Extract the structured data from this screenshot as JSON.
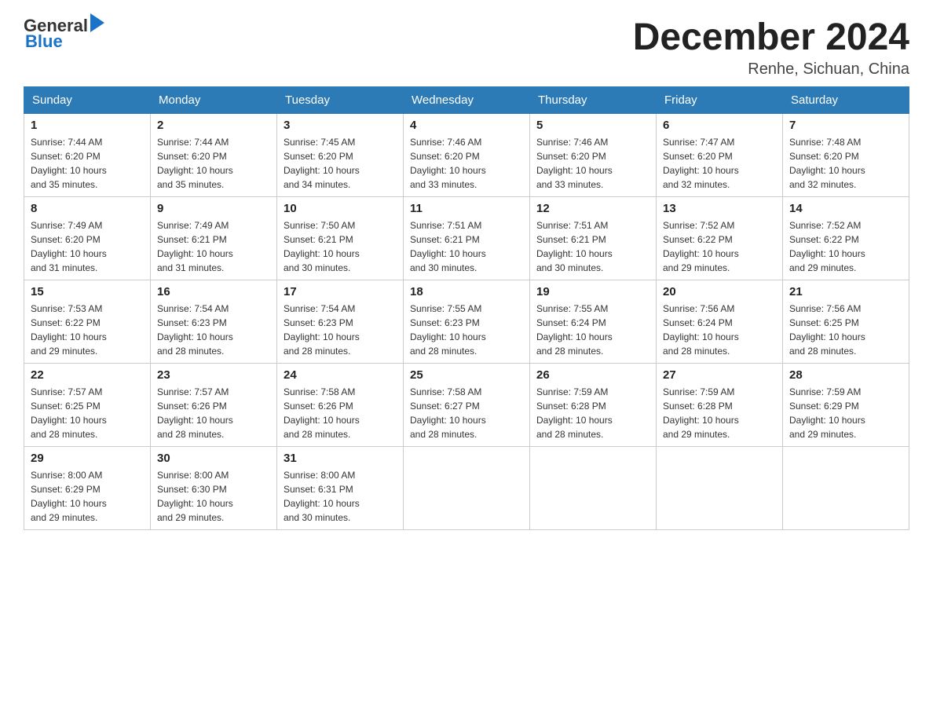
{
  "header": {
    "logo_general": "General",
    "logo_blue": "Blue",
    "title": "December 2024",
    "location": "Renhe, Sichuan, China"
  },
  "calendar": {
    "days_of_week": [
      "Sunday",
      "Monday",
      "Tuesday",
      "Wednesday",
      "Thursday",
      "Friday",
      "Saturday"
    ],
    "weeks": [
      [
        {
          "day": "1",
          "sunrise": "7:44 AM",
          "sunset": "6:20 PM",
          "daylight": "10 hours and 35 minutes."
        },
        {
          "day": "2",
          "sunrise": "7:44 AM",
          "sunset": "6:20 PM",
          "daylight": "10 hours and 35 minutes."
        },
        {
          "day": "3",
          "sunrise": "7:45 AM",
          "sunset": "6:20 PM",
          "daylight": "10 hours and 34 minutes."
        },
        {
          "day": "4",
          "sunrise": "7:46 AM",
          "sunset": "6:20 PM",
          "daylight": "10 hours and 33 minutes."
        },
        {
          "day": "5",
          "sunrise": "7:46 AM",
          "sunset": "6:20 PM",
          "daylight": "10 hours and 33 minutes."
        },
        {
          "day": "6",
          "sunrise": "7:47 AM",
          "sunset": "6:20 PM",
          "daylight": "10 hours and 32 minutes."
        },
        {
          "day": "7",
          "sunrise": "7:48 AM",
          "sunset": "6:20 PM",
          "daylight": "10 hours and 32 minutes."
        }
      ],
      [
        {
          "day": "8",
          "sunrise": "7:49 AM",
          "sunset": "6:20 PM",
          "daylight": "10 hours and 31 minutes."
        },
        {
          "day": "9",
          "sunrise": "7:49 AM",
          "sunset": "6:21 PM",
          "daylight": "10 hours and 31 minutes."
        },
        {
          "day": "10",
          "sunrise": "7:50 AM",
          "sunset": "6:21 PM",
          "daylight": "10 hours and 30 minutes."
        },
        {
          "day": "11",
          "sunrise": "7:51 AM",
          "sunset": "6:21 PM",
          "daylight": "10 hours and 30 minutes."
        },
        {
          "day": "12",
          "sunrise": "7:51 AM",
          "sunset": "6:21 PM",
          "daylight": "10 hours and 30 minutes."
        },
        {
          "day": "13",
          "sunrise": "7:52 AM",
          "sunset": "6:22 PM",
          "daylight": "10 hours and 29 minutes."
        },
        {
          "day": "14",
          "sunrise": "7:52 AM",
          "sunset": "6:22 PM",
          "daylight": "10 hours and 29 minutes."
        }
      ],
      [
        {
          "day": "15",
          "sunrise": "7:53 AM",
          "sunset": "6:22 PM",
          "daylight": "10 hours and 29 minutes."
        },
        {
          "day": "16",
          "sunrise": "7:54 AM",
          "sunset": "6:23 PM",
          "daylight": "10 hours and 28 minutes."
        },
        {
          "day": "17",
          "sunrise": "7:54 AM",
          "sunset": "6:23 PM",
          "daylight": "10 hours and 28 minutes."
        },
        {
          "day": "18",
          "sunrise": "7:55 AM",
          "sunset": "6:23 PM",
          "daylight": "10 hours and 28 minutes."
        },
        {
          "day": "19",
          "sunrise": "7:55 AM",
          "sunset": "6:24 PM",
          "daylight": "10 hours and 28 minutes."
        },
        {
          "day": "20",
          "sunrise": "7:56 AM",
          "sunset": "6:24 PM",
          "daylight": "10 hours and 28 minutes."
        },
        {
          "day": "21",
          "sunrise": "7:56 AM",
          "sunset": "6:25 PM",
          "daylight": "10 hours and 28 minutes."
        }
      ],
      [
        {
          "day": "22",
          "sunrise": "7:57 AM",
          "sunset": "6:25 PM",
          "daylight": "10 hours and 28 minutes."
        },
        {
          "day": "23",
          "sunrise": "7:57 AM",
          "sunset": "6:26 PM",
          "daylight": "10 hours and 28 minutes."
        },
        {
          "day": "24",
          "sunrise": "7:58 AM",
          "sunset": "6:26 PM",
          "daylight": "10 hours and 28 minutes."
        },
        {
          "day": "25",
          "sunrise": "7:58 AM",
          "sunset": "6:27 PM",
          "daylight": "10 hours and 28 minutes."
        },
        {
          "day": "26",
          "sunrise": "7:59 AM",
          "sunset": "6:28 PM",
          "daylight": "10 hours and 28 minutes."
        },
        {
          "day": "27",
          "sunrise": "7:59 AM",
          "sunset": "6:28 PM",
          "daylight": "10 hours and 29 minutes."
        },
        {
          "day": "28",
          "sunrise": "7:59 AM",
          "sunset": "6:29 PM",
          "daylight": "10 hours and 29 minutes."
        }
      ],
      [
        {
          "day": "29",
          "sunrise": "8:00 AM",
          "sunset": "6:29 PM",
          "daylight": "10 hours and 29 minutes."
        },
        {
          "day": "30",
          "sunrise": "8:00 AM",
          "sunset": "6:30 PM",
          "daylight": "10 hours and 29 minutes."
        },
        {
          "day": "31",
          "sunrise": "8:00 AM",
          "sunset": "6:31 PM",
          "daylight": "10 hours and 30 minutes."
        },
        null,
        null,
        null,
        null
      ]
    ],
    "sunrise_label": "Sunrise:",
    "sunset_label": "Sunset:",
    "daylight_label": "Daylight:"
  }
}
